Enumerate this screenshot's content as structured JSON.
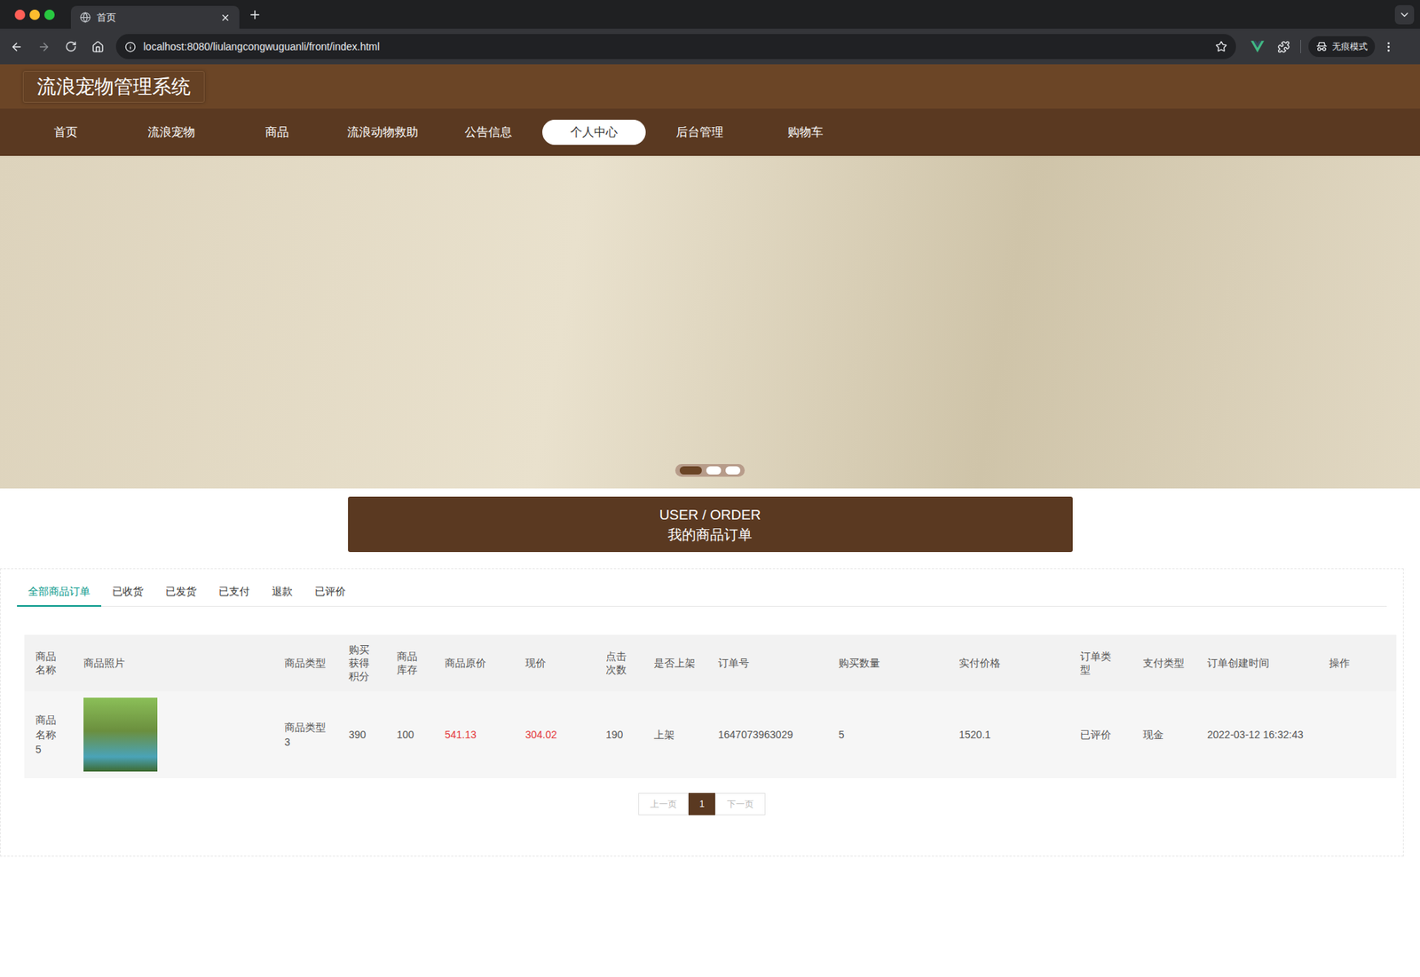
{
  "browser": {
    "tab_title": "首页",
    "url": "localhost:8080/liulangcongwuguanli/front/index.html",
    "profile": "无痕模式"
  },
  "header": {
    "title": "流浪宠物管理系统"
  },
  "nav": [
    {
      "label": "首页",
      "selected": false
    },
    {
      "label": "流浪宠物",
      "selected": false
    },
    {
      "label": "商品",
      "selected": false
    },
    {
      "label": "流浪动物救助",
      "selected": false
    },
    {
      "label": "公告信息",
      "selected": false
    },
    {
      "label": "个人中心",
      "selected": true
    },
    {
      "label": "后台管理",
      "selected": false
    },
    {
      "label": "购物车",
      "selected": false
    }
  ],
  "banner": {
    "dots": [
      {
        "selected": true
      },
      {
        "selected": false
      },
      {
        "selected": false
      }
    ]
  },
  "section": {
    "title_en": "USER / ORDER",
    "title": "我的商品订单"
  },
  "tabs": [
    {
      "label": "全部商品订单",
      "selected": true
    },
    {
      "label": "已收货",
      "selected": false
    },
    {
      "label": "已发货",
      "selected": false
    },
    {
      "label": "已支付",
      "selected": false
    },
    {
      "label": "退款",
      "selected": false
    },
    {
      "label": "已评价",
      "selected": false
    }
  ],
  "table": {
    "columns": [
      {
        "label": "商品名称",
        "kind": "text"
      },
      {
        "label": "商品照片",
        "kind": "image"
      },
      {
        "label": "商品类型",
        "kind": "text"
      },
      {
        "label": "购买获得积分",
        "kind": "text"
      },
      {
        "label": "商品库存",
        "kind": "text"
      },
      {
        "label": "商品原价",
        "kind": "price"
      },
      {
        "label": "现价",
        "kind": "price"
      },
      {
        "label": "点击次数",
        "kind": "text"
      },
      {
        "label": "是否上架",
        "kind": "text"
      },
      {
        "label": "订单号",
        "kind": "text"
      },
      {
        "label": "购买数量",
        "kind": "text"
      },
      {
        "label": "实付价格",
        "kind": "text"
      },
      {
        "label": "订单类型",
        "kind": "text"
      },
      {
        "label": "支付类型",
        "kind": "text"
      },
      {
        "label": "订单创建时间",
        "kind": "text"
      },
      {
        "label": "操作",
        "kind": "text"
      }
    ],
    "rows": [
      {
        "cells": [
          "商品名称5",
          "",
          "商品类型3",
          "390",
          "100",
          "541.13",
          "304.02",
          "190",
          "上架",
          "1647073963029",
          "5",
          "1520.1",
          "已评价",
          "现金",
          "2022-03-12 16:32:43",
          ""
        ]
      }
    ]
  },
  "pagination": {
    "prev": "上一页",
    "prev_disabled": true,
    "pages": [
      {
        "label": "1",
        "selected": true
      }
    ],
    "next": "下一页",
    "next_disabled": true
  }
}
